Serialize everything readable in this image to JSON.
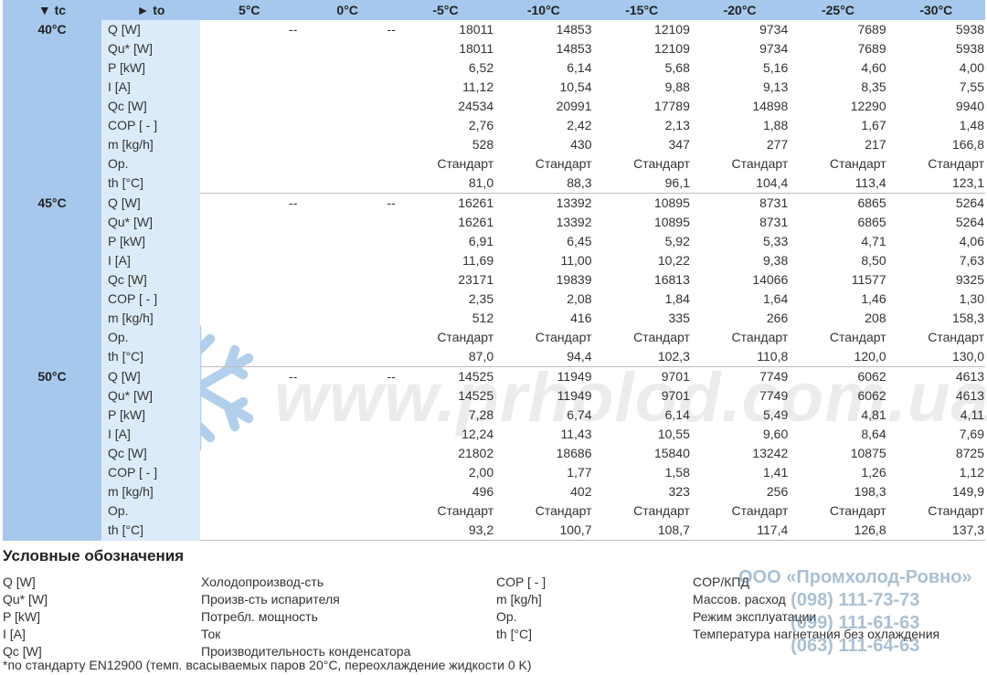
{
  "table": {
    "header": {
      "tc_label": "▼ tc",
      "to_label": "► to",
      "columns": [
        "5°C",
        "0°C",
        "-5°C",
        "-10°C",
        "-15°C",
        "-20°C",
        "-25°C",
        "-30°C"
      ]
    },
    "groups": [
      {
        "tc": "40°C",
        "rows": [
          {
            "param": "Q [W]",
            "values": [
              "--",
              "--",
              "18011",
              "14853",
              "12109",
              "9734",
              "7689",
              "5938"
            ]
          },
          {
            "param": "Qu* [W]",
            "values": [
              "",
              "",
              "18011",
              "14853",
              "12109",
              "9734",
              "7689",
              "5938"
            ]
          },
          {
            "param": "P [kW]",
            "values": [
              "",
              "",
              "6,52",
              "6,14",
              "5,68",
              "5,16",
              "4,60",
              "4,00"
            ]
          },
          {
            "param": "I [A]",
            "values": [
              "",
              "",
              "11,12",
              "10,54",
              "9,88",
              "9,13",
              "8,35",
              "7,55"
            ]
          },
          {
            "param": "Qc [W]",
            "values": [
              "",
              "",
              "24534",
              "20991",
              "17789",
              "14898",
              "12290",
              "9940"
            ]
          },
          {
            "param": "COP [ - ]",
            "values": [
              "",
              "",
              "2,76",
              "2,42",
              "2,13",
              "1,88",
              "1,67",
              "1,48"
            ]
          },
          {
            "param": "m [kg/h]",
            "values": [
              "",
              "",
              "528",
              "430",
              "347",
              "277",
              "217",
              "166,8"
            ]
          },
          {
            "param": "Op.",
            "values": [
              "",
              "",
              "Стандарт",
              "Стандарт",
              "Стандарт",
              "Стандарт",
              "Стандарт",
              "Стандарт"
            ]
          },
          {
            "param": "th [°C]",
            "values": [
              "",
              "",
              "81,0",
              "88,3",
              "96,1",
              "104,4",
              "113,4",
              "123,1"
            ]
          }
        ]
      },
      {
        "tc": "45°C",
        "rows": [
          {
            "param": "Q [W]",
            "values": [
              "--",
              "--",
              "16261",
              "13392",
              "10895",
              "8731",
              "6865",
              "5264"
            ]
          },
          {
            "param": "Qu* [W]",
            "values": [
              "",
              "",
              "16261",
              "13392",
              "10895",
              "8731",
              "6865",
              "5264"
            ]
          },
          {
            "param": "P [kW]",
            "values": [
              "",
              "",
              "6,91",
              "6,45",
              "5,92",
              "5,33",
              "4,71",
              "4,06"
            ]
          },
          {
            "param": "I [A]",
            "values": [
              "",
              "",
              "11,69",
              "11,00",
              "10,22",
              "9,38",
              "8,50",
              "7,63"
            ]
          },
          {
            "param": "Qc [W]",
            "values": [
              "",
              "",
              "23171",
              "19839",
              "16813",
              "14066",
              "11577",
              "9325"
            ]
          },
          {
            "param": "COP [ - ]",
            "values": [
              "",
              "",
              "2,35",
              "2,08",
              "1,84",
              "1,64",
              "1,46",
              "1,30"
            ]
          },
          {
            "param": "m [kg/h]",
            "values": [
              "",
              "",
              "512",
              "416",
              "335",
              "266",
              "208",
              "158,3"
            ]
          },
          {
            "param": "Op.",
            "values": [
              "",
              "",
              "Стандарт",
              "Стандарт",
              "Стандарт",
              "Стандарт",
              "Стандарт",
              "Стандарт"
            ]
          },
          {
            "param": "th [°C]",
            "values": [
              "",
              "",
              "87,0",
              "94,4",
              "102,3",
              "110,8",
              "120,0",
              "130,0"
            ]
          }
        ]
      },
      {
        "tc": "50°C",
        "rows": [
          {
            "param": "Q [W]",
            "values": [
              "--",
              "--",
              "14525",
              "11949",
              "9701",
              "7749",
              "6062",
              "4613"
            ]
          },
          {
            "param": "Qu* [W]",
            "values": [
              "",
              "",
              "14525",
              "11949",
              "9701",
              "7749",
              "6062",
              "4613"
            ]
          },
          {
            "param": "P [kW]",
            "values": [
              "",
              "",
              "7,28",
              "6,74",
              "6,14",
              "5,49",
              "4,81",
              "4,11"
            ]
          },
          {
            "param": "I [A]",
            "values": [
              "",
              "",
              "12,24",
              "11,43",
              "10,55",
              "9,60",
              "8,64",
              "7,69"
            ]
          },
          {
            "param": "Qc [W]",
            "values": [
              "",
              "",
              "21802",
              "18686",
              "15840",
              "13242",
              "10875",
              "8725"
            ]
          },
          {
            "param": "COP [ - ]",
            "values": [
              "",
              "",
              "2,00",
              "1,77",
              "1,58",
              "1,41",
              "1,26",
              "1,12"
            ]
          },
          {
            "param": "m [kg/h]",
            "values": [
              "",
              "",
              "496",
              "402",
              "323",
              "256",
              "198,3",
              "149,9"
            ]
          },
          {
            "param": "Op.",
            "values": [
              "",
              "",
              "Стандарт",
              "Стандарт",
              "Стандарт",
              "Стандарт",
              "Стандарт",
              "Стандарт"
            ]
          },
          {
            "param": "th [°C]",
            "values": [
              "",
              "",
              "93,2",
              "100,7",
              "108,7",
              "117,4",
              "126,8",
              "137,3"
            ]
          }
        ]
      }
    ]
  },
  "legend": {
    "title": "Условные обозначения",
    "items": [
      {
        "symbol": "Q [W]",
        "meaning": "Холодопроизвод-сть"
      },
      {
        "symbol": "Qu* [W]",
        "meaning": "Произв-сть испарителя"
      },
      {
        "symbol": "P [kW]",
        "meaning": "Потребл. мощность"
      },
      {
        "symbol": "I [A]",
        "meaning": "Ток"
      },
      {
        "symbol": "Qc [W]",
        "meaning": "Производительность конденсатора"
      },
      {
        "symbol": "COP [ - ]",
        "meaning": "COP/КПД"
      },
      {
        "symbol": "m [kg/h]",
        "meaning": "Массов. расход"
      },
      {
        "symbol": "Op.",
        "meaning": "Режим эксплуатации"
      },
      {
        "symbol": "th [°C]",
        "meaning": "Температура нагнетания без охлаждения"
      }
    ],
    "footnote": "*по стандарту EN12900 (темп. всасываемых паров 20°C, переохлаждение жидкости 0 K)"
  },
  "watermark": {
    "url": "www.prholod.com.ua",
    "company": "ООО «Промхолод-Ровно»",
    "phones": [
      "(098) 111-73-73",
      "(099) 111-61-63",
      "(063) 111-64-63"
    ]
  },
  "colors": {
    "header_bg": "#a6c8ec",
    "param_bg": "#dcebfa",
    "divider": "#bdbdbd"
  }
}
